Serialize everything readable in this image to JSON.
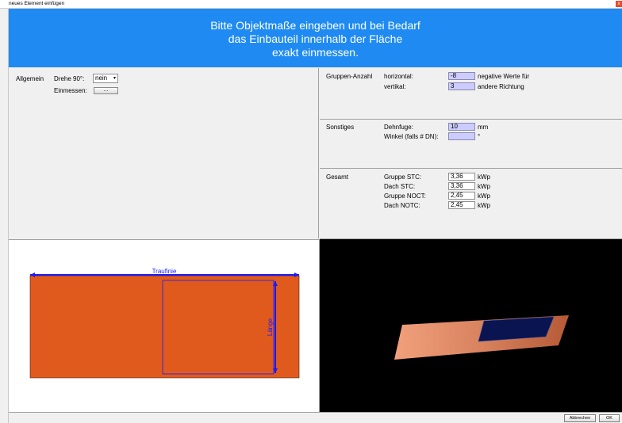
{
  "window": {
    "title": "neues Element einfügen",
    "close_glyph": "x"
  },
  "banner": {
    "line1": "Bitte Objektmaße eingeben und bei Bedarf",
    "line2": "das Einbauteil innerhalb der Fläche",
    "line3": "exakt einmessen."
  },
  "allgemein": {
    "section": "Allgemein",
    "drehe_label": "Drehe 90°:",
    "drehe_value": "nein",
    "einmessen_label": "Einmessen:",
    "einmessen_button": "..."
  },
  "gruppen": {
    "section": "Gruppen-Anzahl",
    "horizontal_label": "horizontal:",
    "horizontal_value": "-8",
    "vertikal_label": "vertikal:",
    "vertikal_value": "3",
    "note1": "negative Werte für",
    "note2": "andere Richtung"
  },
  "sonstiges": {
    "section": "Sonstiges",
    "dehnfuge_label": "Dehnfuge:",
    "dehnfuge_value": "10",
    "dehnfuge_unit": "mm",
    "winkel_label": "Winkel (falls # DN):",
    "winkel_value": "",
    "winkel_unit": "°"
  },
  "gesamt": {
    "section": "Gesamt",
    "rows": [
      {
        "label": "Gruppe STC:",
        "value": "3,36",
        "unit": "kWp"
      },
      {
        "label": "Dach STC:",
        "value": "3,36",
        "unit": "kWp"
      },
      {
        "label": "Gruppe NOCT:",
        "value": "2,45",
        "unit": "kWp"
      },
      {
        "label": "Dach NOTC:",
        "value": "2,45",
        "unit": "kWp"
      }
    ]
  },
  "drawing": {
    "traufe_label": "Traufinie",
    "laenge_label": "Länge",
    "roof_color": "#e05a1e",
    "line_color": "#1a1aff"
  },
  "footer": {
    "cancel_label": "Abbrechen",
    "ok_label": "OK"
  }
}
